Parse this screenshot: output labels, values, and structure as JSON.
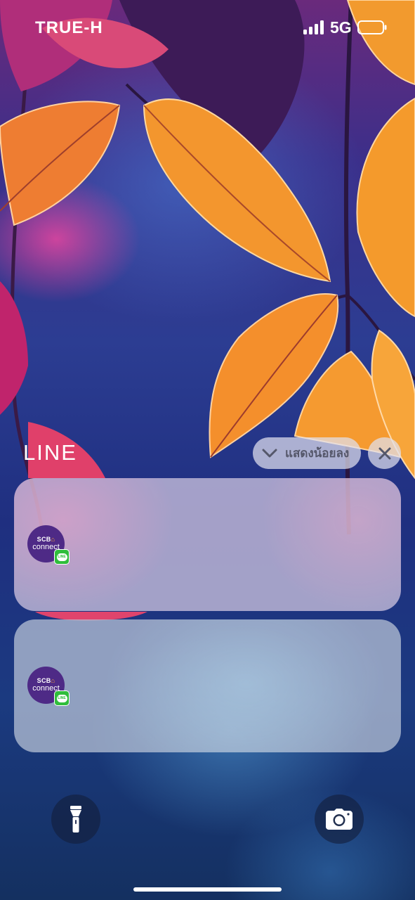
{
  "status_bar": {
    "carrier": "TRUE-H",
    "network": "5G",
    "signal_bars": 4,
    "battery_level": 0.0,
    "icons": [
      "signal-icon",
      "battery-icon"
    ]
  },
  "notification_group": {
    "app_name": "LINE",
    "show_less_label": "แสดงน้อยลง",
    "show_less_icon": "chevron-down-icon",
    "close_icon": "close-icon"
  },
  "notifications": [
    {
      "avatar_line1": "SCB",
      "avatar_house": "⌂",
      "avatar_line2": "connect",
      "badge_label": "LINE"
    },
    {
      "avatar_line1": "SCB",
      "avatar_house": "⌂",
      "avatar_line2": "connect",
      "badge_label": "LINE"
    }
  ],
  "bottom_controls": {
    "left_icon": "flashlight-icon",
    "right_icon": "camera-icon"
  },
  "colors": {
    "line_green": "#2fbd3b",
    "scb_purple": "#4e2a86",
    "scb_accent": "#f2a33a"
  }
}
